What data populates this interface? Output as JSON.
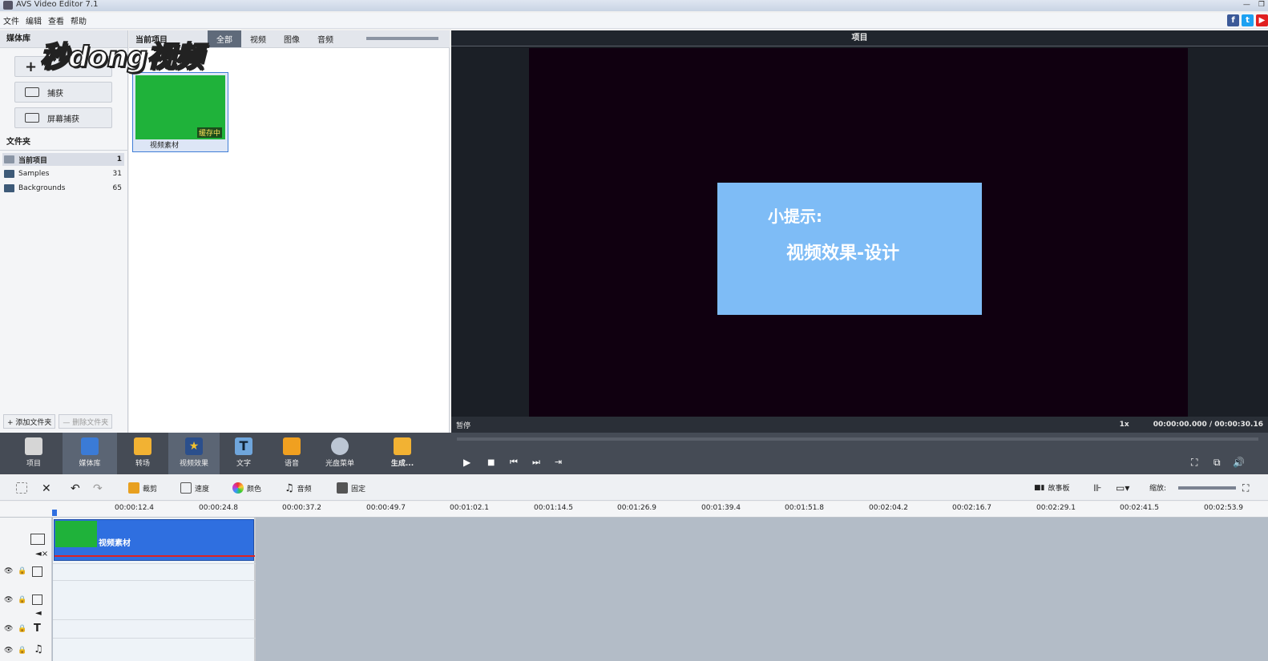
{
  "window": {
    "title": "AVS Video Editor 7.1"
  },
  "menu": [
    "文件",
    "编辑",
    "查看",
    "帮助"
  ],
  "social": [
    "f",
    "t",
    "▶"
  ],
  "library": {
    "header": "媒体库",
    "add_symbol": "+",
    "capture_label": "捕获",
    "screen_capture_label": "屏幕捕获",
    "folders_header": "文件夹",
    "folders": [
      {
        "name": "当前项目",
        "count": "1"
      },
      {
        "name": "Samples",
        "count": "31"
      },
      {
        "name": "Backgrounds",
        "count": "65"
      }
    ],
    "add_folder": "+ 添加文件夹",
    "remove_folder": "— 删除文件夹"
  },
  "media": {
    "header": "当前项目",
    "tabs": [
      "全部",
      "视频",
      "图像",
      "音频"
    ],
    "active_tab": "全部",
    "thumb_badge": "缓存中",
    "thumb_label": "视频素材",
    "watermark": "秒dong视频"
  },
  "preview": {
    "header": "项目",
    "card_line1": "小提示:",
    "card_line2": "视频效果-设计",
    "status": "暂停",
    "speed": "1x",
    "timecode": "00:00:00.000 / 00:00:30.16"
  },
  "toolbar": [
    {
      "label": "项目",
      "icon": "clapper-icon",
      "color": "#d6d6d6"
    },
    {
      "label": "媒体库",
      "icon": "media-library-icon",
      "color": "#3b7bd6"
    },
    {
      "label": "转场",
      "icon": "transition-icon",
      "color": "#f2b233"
    },
    {
      "label": "视频效果",
      "icon": "video-effect-icon",
      "color": "#2b4f8c"
    },
    {
      "label": "文字",
      "icon": "text-T-icon",
      "color": "#6fa6dc"
    },
    {
      "label": "语音",
      "icon": "microphone-icon",
      "color": "#f0a020"
    },
    {
      "label": "光盘菜单",
      "icon": "disc-menu-icon",
      "color": "#bcc6d4"
    },
    {
      "label": "生成...",
      "icon": "produce-icon",
      "color": "#f2b233"
    }
  ],
  "timeline_tools": {
    "crop": "裁剪",
    "speed": "速度",
    "color": "颜色",
    "audio": "音频",
    "freeze": "固定",
    "storyboard": "故事板",
    "zoom": "缩放:"
  },
  "ruler": [
    "00:00:12.4",
    "00:00:24.8",
    "00:00:37.2",
    "00:00:49.7",
    "00:01:02.1",
    "00:01:14.5",
    "00:01:26.9",
    "00:01:39.4",
    "00:01:51.8",
    "00:02:04.2",
    "00:02:16.7",
    "00:02:29.1",
    "00:02:41.5",
    "00:02:53.9"
  ],
  "clip": {
    "label": "视频素材"
  }
}
